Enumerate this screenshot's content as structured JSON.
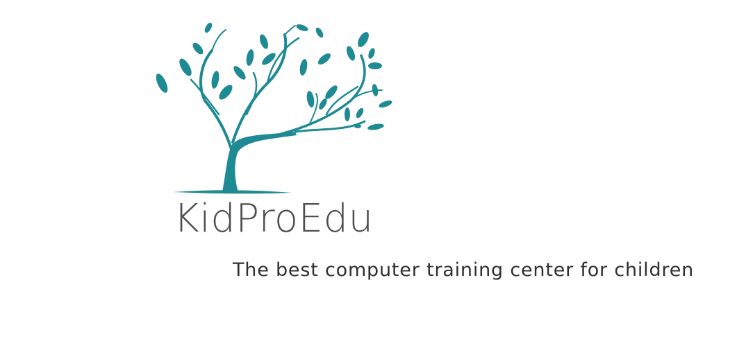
{
  "logo": {
    "icon": "tree-icon",
    "color": "#1e8a93",
    "brand_name": "KidProEdu"
  },
  "tagline": "The best computer training center for children"
}
